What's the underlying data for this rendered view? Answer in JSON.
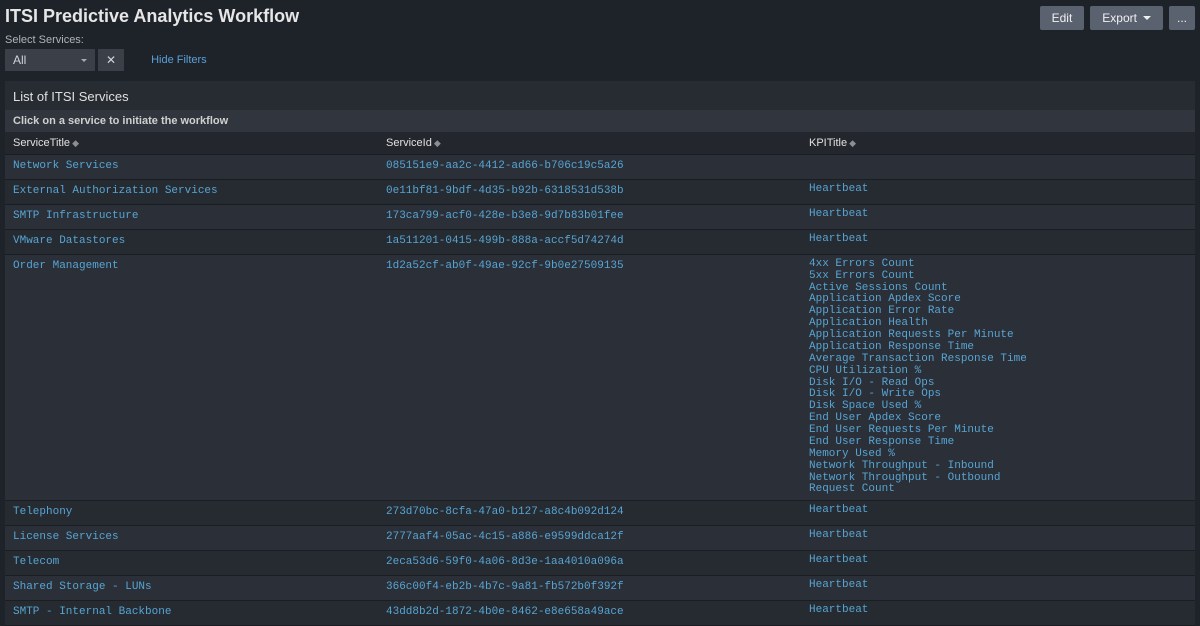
{
  "header": {
    "title": "ITSI Predictive Analytics Workflow",
    "edit": "Edit",
    "export": "Export",
    "more": "..."
  },
  "filters": {
    "label": "Select Services:",
    "value": "All",
    "clear": "✕",
    "hide": "Hide Filters"
  },
  "section": {
    "title": "List of ITSI Services",
    "subtitle": "Click on a service to initiate the workflow"
  },
  "columns": {
    "service_title": "ServiceTitle",
    "service_id": "ServiceId",
    "kpi_title": "KPITitle"
  },
  "rows": [
    {
      "title": "Network Services",
      "id": "085151e9-aa2c-4412-ad66-b706c19c5a26",
      "kpis": []
    },
    {
      "title": "External Authorization Services",
      "id": "0e11bf81-9bdf-4d35-b92b-6318531d538b",
      "kpis": [
        "Heartbeat"
      ]
    },
    {
      "title": "SMTP Infrastructure",
      "id": "173ca799-acf0-428e-b3e8-9d7b83b01fee",
      "kpis": [
        "Heartbeat"
      ]
    },
    {
      "title": "VMware Datastores",
      "id": "1a511201-0415-499b-888a-accf5d74274d",
      "kpis": [
        "Heartbeat"
      ]
    },
    {
      "title": "Order Management",
      "id": "1d2a52cf-ab0f-49ae-92cf-9b0e27509135",
      "kpis": [
        "4xx Errors Count",
        "5xx Errors Count",
        "Active Sessions Count",
        "Application Apdex Score",
        "Application Error Rate",
        "Application Health",
        "Application Requests Per Minute",
        "Application Response Time",
        "Average Transaction Response Time",
        "CPU Utilization %",
        "Disk I/O - Read Ops",
        "Disk I/O - Write Ops",
        "Disk Space Used %",
        "End User Apdex Score",
        "End User Requests Per Minute",
        "End User Response Time",
        "Memory Used %",
        "Network Throughput - Inbound",
        "Network Throughput - Outbound",
        "Request Count"
      ]
    },
    {
      "title": "Telephony",
      "id": "273d70bc-8cfa-47a0-b127-a8c4b092d124",
      "kpis": [
        "Heartbeat"
      ]
    },
    {
      "title": "License Services",
      "id": "2777aaf4-05ac-4c15-a886-e9599ddca12f",
      "kpis": [
        "Heartbeat"
      ]
    },
    {
      "title": "Telecom",
      "id": "2eca53d6-59f0-4a06-8d3e-1aa4010a096a",
      "kpis": [
        "Heartbeat"
      ]
    },
    {
      "title": "Shared Storage - LUNs",
      "id": "366c00f4-eb2b-4b7c-9a81-fb572b0f392f",
      "kpis": [
        "Heartbeat"
      ]
    },
    {
      "title": "SMTP - Internal Backbone",
      "id": "43dd8b2d-1872-4b0e-8462-e8e658a49ace",
      "kpis": [
        "Heartbeat"
      ]
    }
  ]
}
